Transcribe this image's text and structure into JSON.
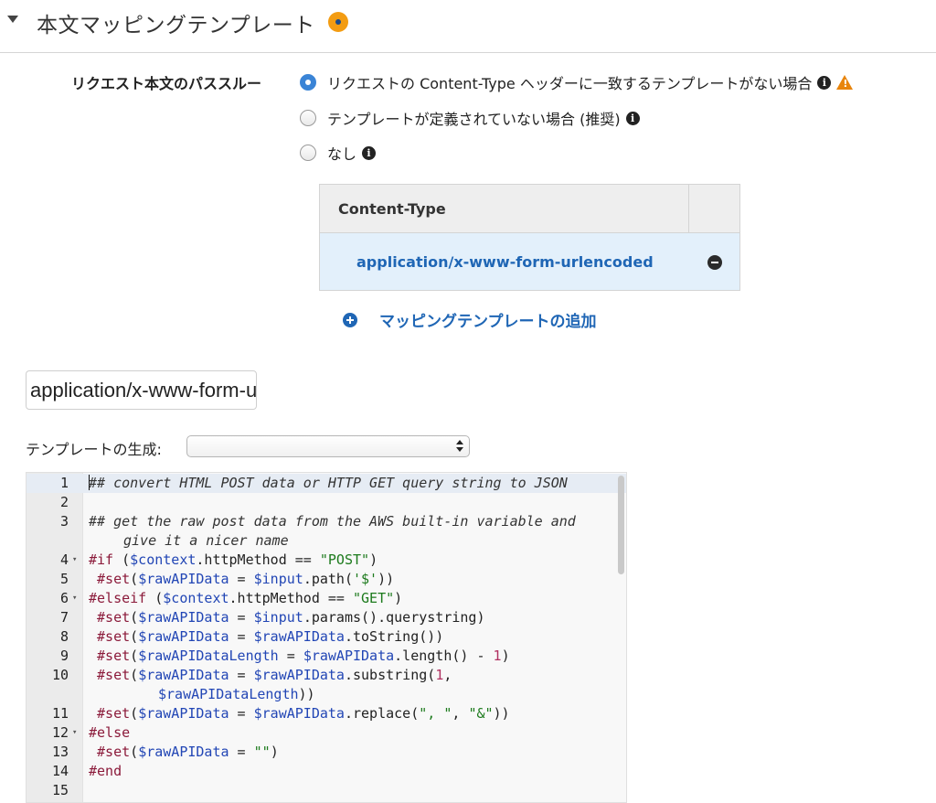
{
  "section": {
    "title": "本文マッピングテンプレート"
  },
  "passthrough": {
    "label": "リクエスト本文のパススルー",
    "options": [
      {
        "label": "リクエストの Content-Type ヘッダーに一致するテンプレートがない場合",
        "selected": true
      },
      {
        "label": "テンプレートが定義されていない場合 (推奨)",
        "selected": false
      },
      {
        "label": "なし",
        "selected": false
      }
    ]
  },
  "content_type_table": {
    "header": "Content-Type",
    "rows": [
      "application/x-www-form-urlencoded"
    ]
  },
  "add_template": {
    "label": "マッピングテンプレートの追加"
  },
  "content_type_input": {
    "value": "application/x-www-form-urlencoded"
  },
  "generate_template": {
    "label": "テンプレートの生成:",
    "selected": ""
  },
  "editor": {
    "lines": [
      {
        "n": "1",
        "text": "## convert HTML POST data or HTTP GET query string to JSON"
      },
      {
        "n": "2",
        "text": ""
      },
      {
        "n": "3",
        "text": "## get the raw post data from the AWS built-in variable and",
        "wrap": "give it a nicer name"
      },
      {
        "n": "4",
        "text": "#if ($context.httpMethod == \"POST\")",
        "fold": true
      },
      {
        "n": "5",
        "text": " #set($rawAPIData = $input.path('$'))"
      },
      {
        "n": "6",
        "text": "#elseif ($context.httpMethod == \"GET\")",
        "fold": true
      },
      {
        "n": "7",
        "text": " #set($rawAPIData = $input.params().querystring)"
      },
      {
        "n": "8",
        "text": " #set($rawAPIData = $rawAPIData.toString())"
      },
      {
        "n": "9",
        "text": " #set($rawAPIDataLength = $rawAPIData.length() - 1)"
      },
      {
        "n": "10",
        "text": " #set($rawAPIData = $rawAPIData.substring(1,",
        "wrap": "$rawAPIDataLength))"
      },
      {
        "n": "11",
        "text": " #set($rawAPIData = $rawAPIData.replace(\", \", \"&\"))"
      },
      {
        "n": "12",
        "text": "#else",
        "fold": true
      },
      {
        "n": "13",
        "text": " #set($rawAPIData = \"\")"
      },
      {
        "n": "14",
        "text": "#end"
      },
      {
        "n": "15",
        "text": ""
      }
    ]
  },
  "colors": {
    "accent": "#1f66b5",
    "radio_selected": "#3a84d6",
    "warning": "#e8850c",
    "status_dot": "#f39c12",
    "selected_row_bg": "#e3f0fb"
  }
}
